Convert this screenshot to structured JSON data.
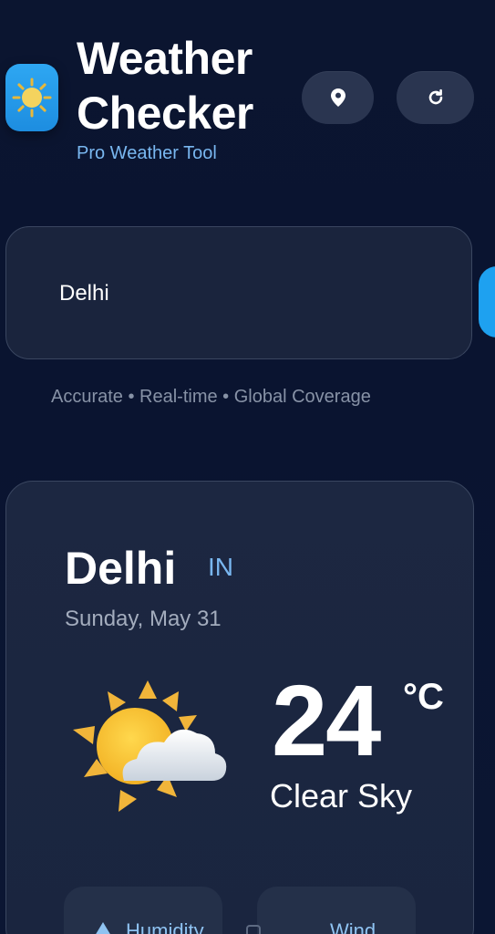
{
  "header": {
    "title_line1": "Weather",
    "title_line2": "Checker",
    "subtitle": "Pro Weather Tool",
    "icons": {
      "app": "sun-icon",
      "location": "location-pin-icon",
      "refresh": "refresh-icon"
    }
  },
  "search": {
    "value": "Delhi"
  },
  "tagline": "Accurate • Real-time • Global Coverage",
  "weather": {
    "city": "Delhi",
    "country": "IN",
    "date": "Sunday, May 31",
    "temperature": "24",
    "unit": "°C",
    "condition": "Clear Sky",
    "icon": "sun-behind-cloud-icon"
  },
  "stats": {
    "humidity_label": "Humidity",
    "wind_label": "Wind"
  },
  "colors": {
    "background": "#0b1530",
    "accent": "#1ea1f0",
    "subtitle": "#79b7f0",
    "card": "#1c2741"
  }
}
